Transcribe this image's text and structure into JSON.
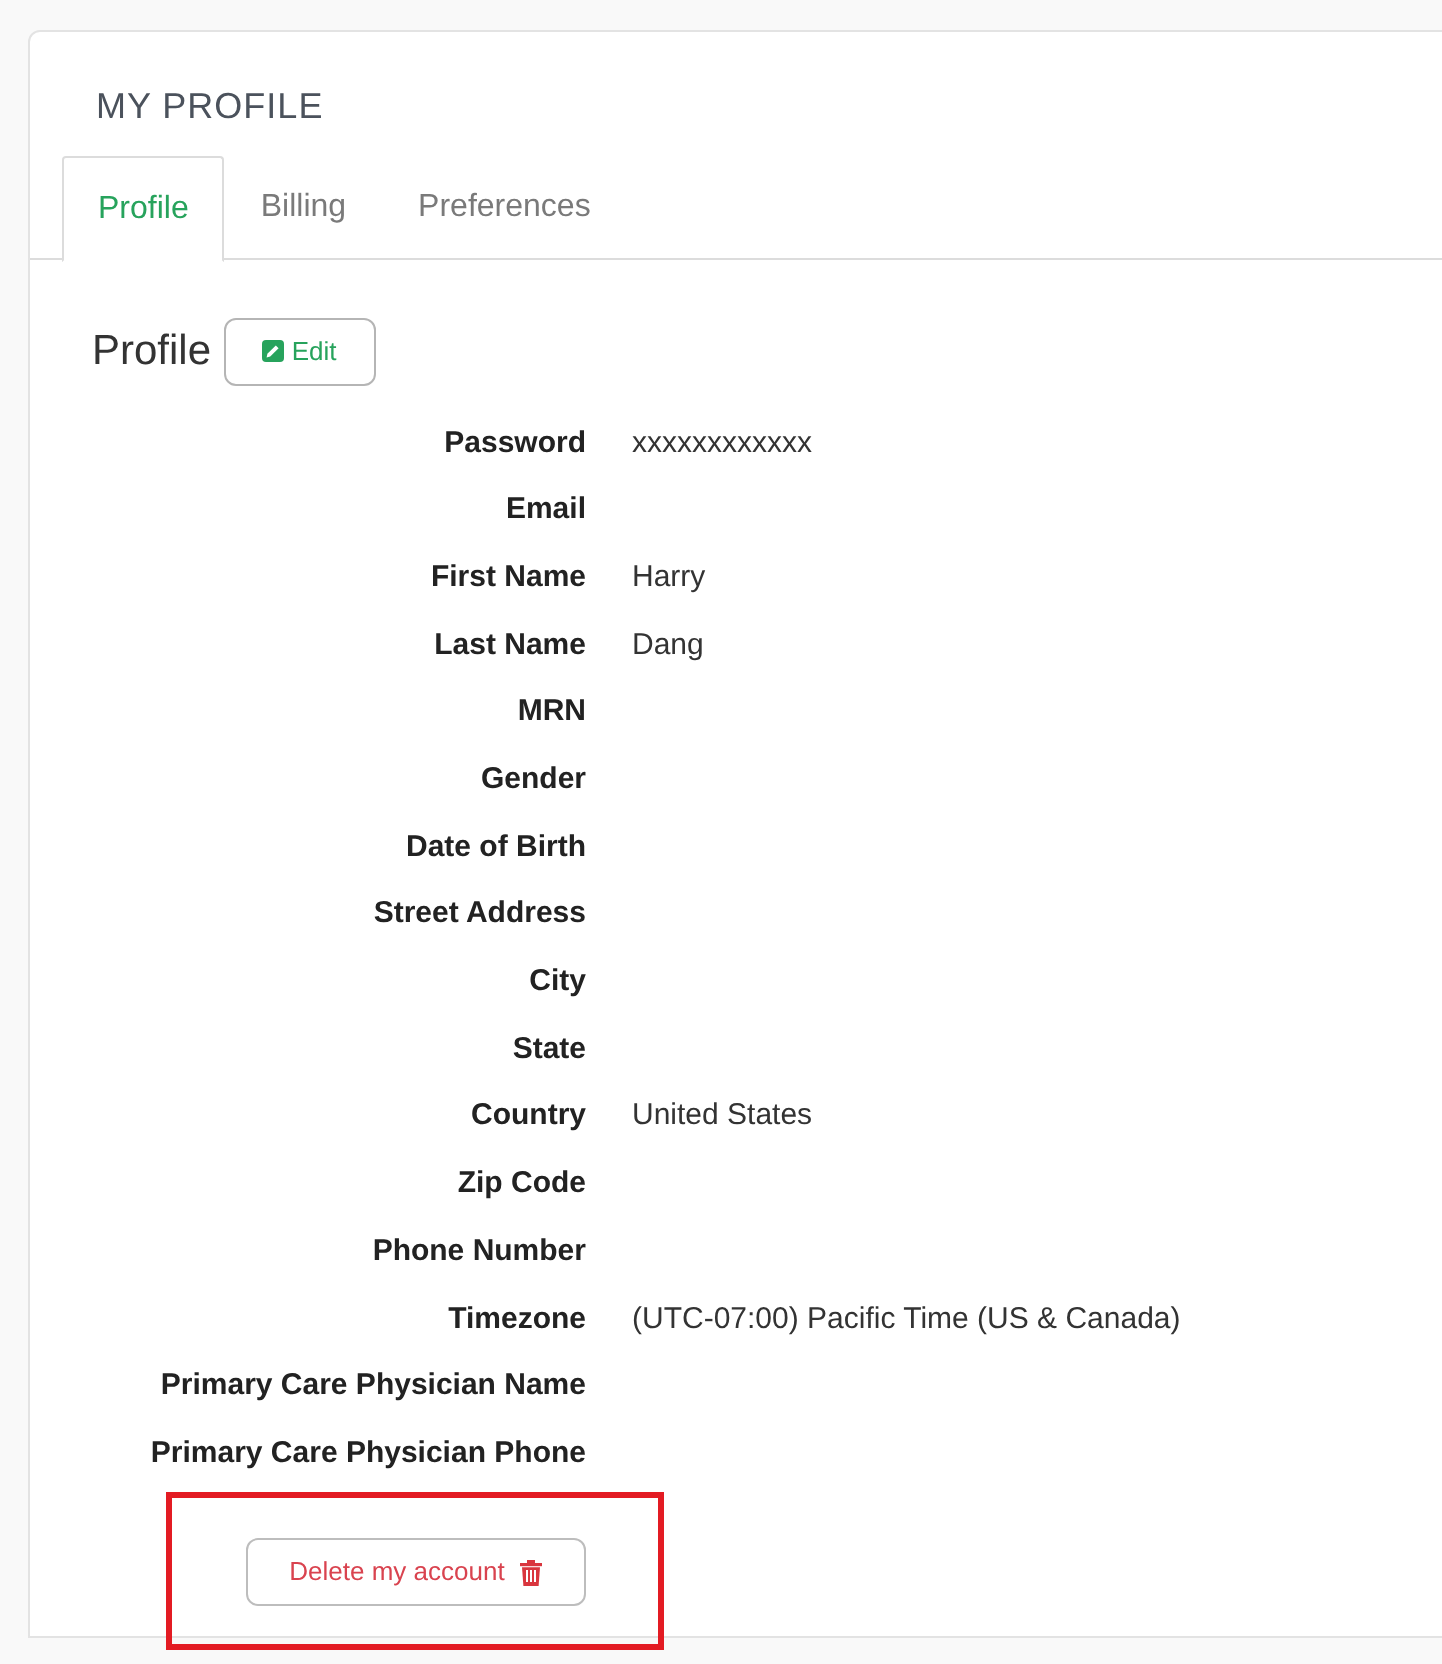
{
  "page": {
    "title": "MY PROFILE"
  },
  "tabs": [
    {
      "label": "Profile",
      "selected": true
    },
    {
      "label": "Billing",
      "selected": false
    },
    {
      "label": "Preferences",
      "selected": false
    }
  ],
  "section": {
    "title": "Profile",
    "edit_button": "Edit"
  },
  "fields": [
    {
      "label": "Password",
      "value": "xxxxxxxxxxxx"
    },
    {
      "label": "Email"
    },
    {
      "label": "First Name",
      "value": "Harry"
    },
    {
      "label": "Last Name",
      "value": "Dang"
    },
    {
      "label": "MRN"
    },
    {
      "label": "Gender"
    },
    {
      "label": "Date of Birth"
    },
    {
      "label": "Street Address"
    },
    {
      "label": "City"
    },
    {
      "label": "State"
    },
    {
      "label": "Country",
      "value": "United States"
    },
    {
      "label": "Zip Code"
    },
    {
      "label": "Phone Number"
    },
    {
      "label": "Timezone",
      "value": "(UTC-07:00) Pacific Time (US & Canada)"
    },
    {
      "label": "Primary Care Physician Name"
    },
    {
      "label": "Primary Care Physician Phone"
    }
  ],
  "delete_button": {
    "label": "Delete my account",
    "highlighted": true
  }
}
